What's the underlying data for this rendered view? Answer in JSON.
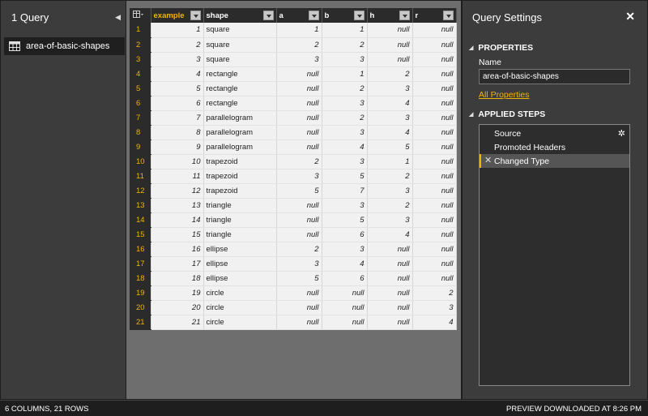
{
  "queries_pane": {
    "title": "1 Query",
    "items": [
      {
        "label": "area-of-basic-shapes"
      }
    ]
  },
  "grid": {
    "columns": [
      "example",
      "shape",
      "a",
      "b",
      "h",
      "r"
    ],
    "rows": [
      [
        "1",
        "1",
        "square",
        "1",
        "1",
        "null",
        "null"
      ],
      [
        "2",
        "2",
        "square",
        "2",
        "2",
        "null",
        "null"
      ],
      [
        "3",
        "3",
        "square",
        "3",
        "3",
        "null",
        "null"
      ],
      [
        "4",
        "4",
        "rectangle",
        "null",
        "1",
        "2",
        "null"
      ],
      [
        "5",
        "5",
        "rectangle",
        "null",
        "2",
        "3",
        "null"
      ],
      [
        "6",
        "6",
        "rectangle",
        "null",
        "3",
        "4",
        "null"
      ],
      [
        "7",
        "7",
        "parallelogram",
        "null",
        "2",
        "3",
        "null"
      ],
      [
        "8",
        "8",
        "parallelogram",
        "null",
        "3",
        "4",
        "null"
      ],
      [
        "9",
        "9",
        "parallelogram",
        "null",
        "4",
        "5",
        "null"
      ],
      [
        "10",
        "10",
        "trapezoid",
        "2",
        "3",
        "1",
        "null"
      ],
      [
        "11",
        "11",
        "trapezoid",
        "3",
        "5",
        "2",
        "null"
      ],
      [
        "12",
        "12",
        "trapezoid",
        "5",
        "7",
        "3",
        "null"
      ],
      [
        "13",
        "13",
        "triangle",
        "null",
        "3",
        "2",
        "null"
      ],
      [
        "14",
        "14",
        "triangle",
        "null",
        "5",
        "3",
        "null"
      ],
      [
        "15",
        "15",
        "triangle",
        "null",
        "6",
        "4",
        "null"
      ],
      [
        "16",
        "16",
        "ellipse",
        "2",
        "3",
        "null",
        "null"
      ],
      [
        "17",
        "17",
        "ellipse",
        "3",
        "4",
        "null",
        "null"
      ],
      [
        "18",
        "18",
        "ellipse",
        "5",
        "6",
        "null",
        "null"
      ],
      [
        "19",
        "19",
        "circle",
        "null",
        "null",
        "null",
        "2"
      ],
      [
        "20",
        "20",
        "circle",
        "null",
        "null",
        "null",
        "3"
      ],
      [
        "21",
        "21",
        "circle",
        "null",
        "null",
        "null",
        "4"
      ]
    ]
  },
  "settings": {
    "title": "Query Settings",
    "close_glyph": "✕",
    "properties_heading": "PROPERTIES",
    "name_label": "Name",
    "name_value": "area-of-basic-shapes",
    "all_properties_link": "All Properties",
    "steps_heading": "APPLIED STEPS",
    "steps": [
      {
        "label": "Source",
        "has_gear": true,
        "selected": false
      },
      {
        "label": "Promoted Headers",
        "has_gear": false,
        "selected": false
      },
      {
        "label": "Changed Type",
        "has_gear": false,
        "selected": true
      }
    ]
  },
  "status_bar": {
    "left": "6 COLUMNS, 21 ROWS",
    "right": "PREVIEW DOWNLOADED AT 8:26 PM"
  },
  "colors": {
    "accent": "#f0b400",
    "pane_bg": "#3c3c3c",
    "grid_bg": "#6e6e6e"
  }
}
